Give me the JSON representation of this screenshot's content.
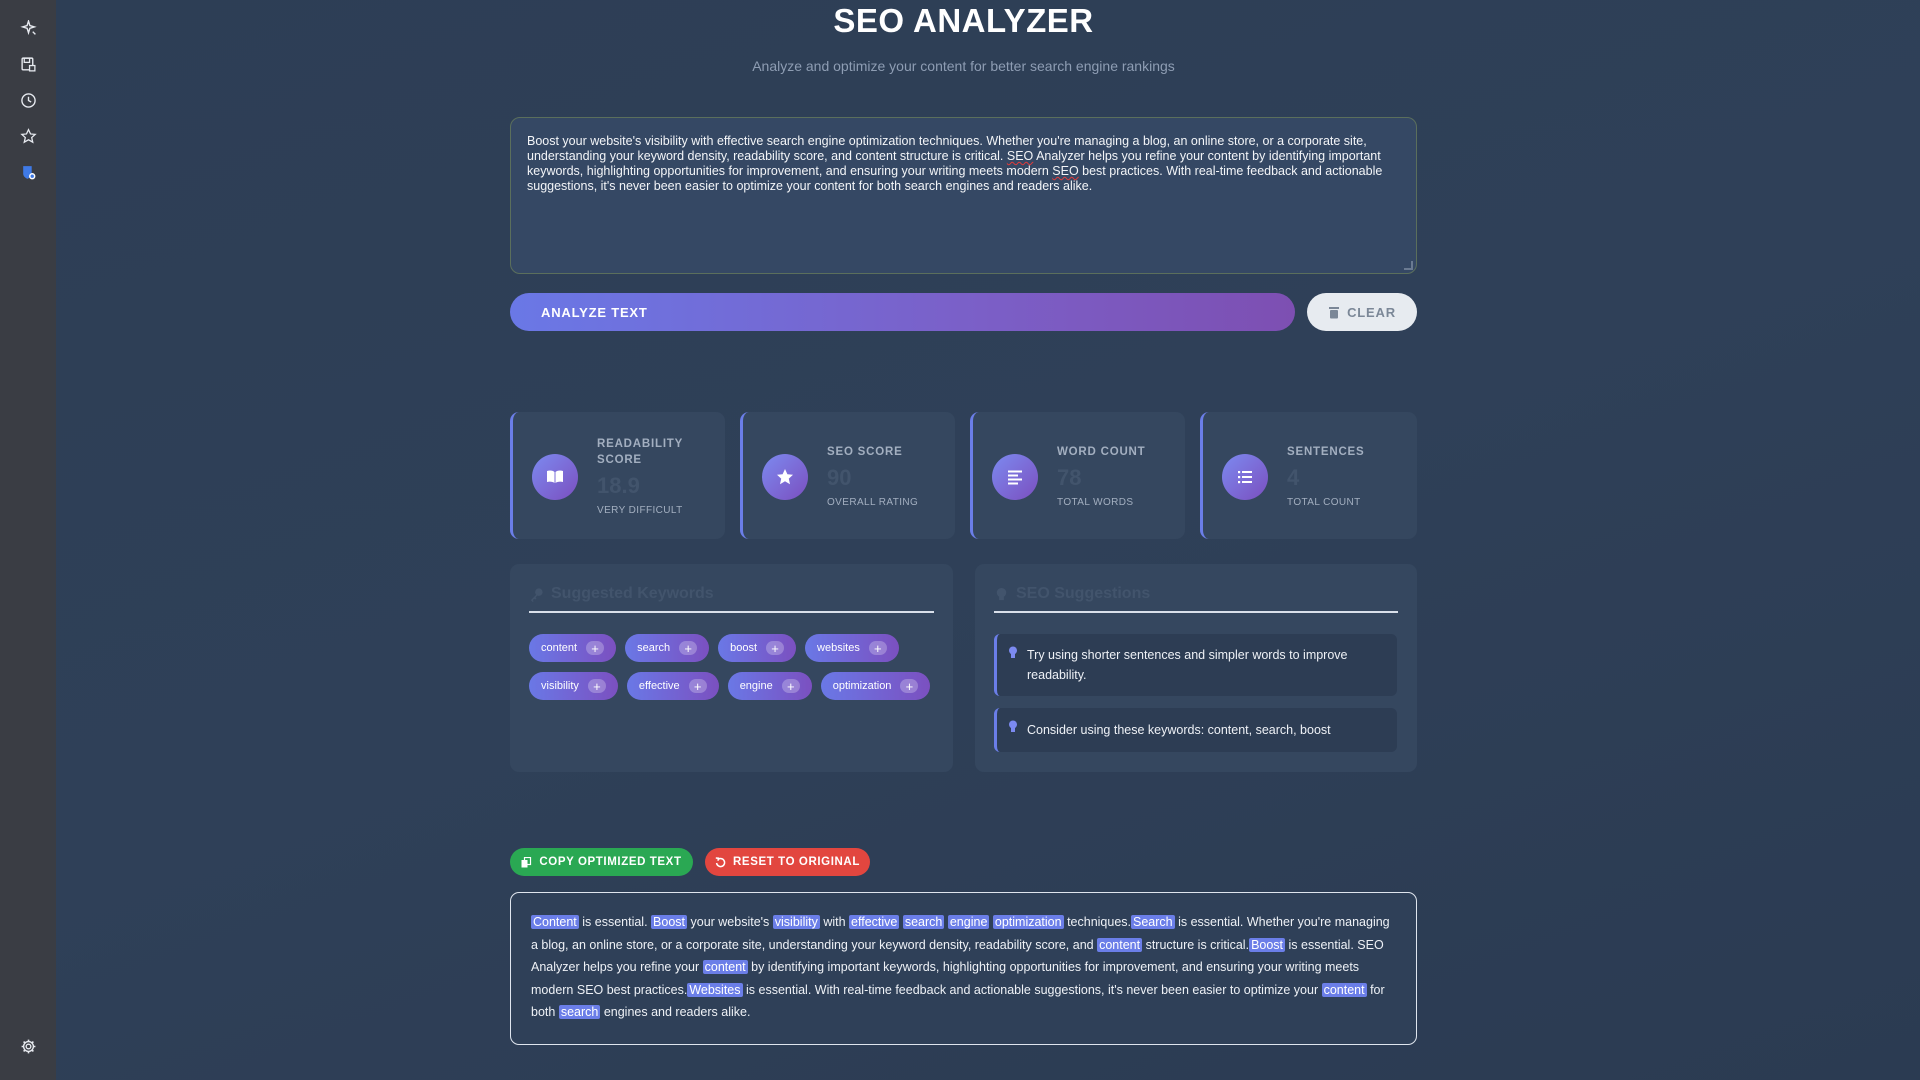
{
  "sidebar": {
    "icons": [
      "sparkle-edit-icon",
      "save-icon",
      "history-icon",
      "star-icon",
      "shield-icon"
    ],
    "bottom_icon": "settings-icon"
  },
  "header": {
    "title": "SEO ANALYZER",
    "subtitle": "Analyze and optimize your content for better search engine rankings"
  },
  "editor": {
    "segments": [
      {
        "text": "Boost your website's visibility with effective search engine optimization techniques. Whether you're managing a blog, an online store, or a corporate site, understanding your keyword density, readability score, and content structure is critical. ",
        "spell": false
      },
      {
        "text": "SEO",
        "spell": true
      },
      {
        "text": " Analyzer helps you refine your content by identifying important keywords, highlighting opportunities for improvement, and ensuring your writing meets modern ",
        "spell": false
      },
      {
        "text": "SEO",
        "spell": true
      },
      {
        "text": " best practices. With real-time feedback and actionable suggestions, it's never been easier to optimize your content for both search engines and readers alike.",
        "spell": false
      }
    ]
  },
  "actions": {
    "analyze_label": "ANALYZE TEXT",
    "clear_label": "CLEAR"
  },
  "stats": [
    {
      "label": "READABILITY SCORE",
      "value": "18.9",
      "sub": "VERY DIFFICULT",
      "icon": "book-icon"
    },
    {
      "label": "SEO SCORE",
      "value": "90",
      "sub": "OVERALL RATING",
      "icon": "star-icon"
    },
    {
      "label": "WORD COUNT",
      "value": "78",
      "sub": "TOTAL WORDS",
      "icon": "align-left-icon"
    },
    {
      "label": "SENTENCES",
      "value": "4",
      "sub": "TOTAL COUNT",
      "icon": "list-icon"
    }
  ],
  "keywords_panel": {
    "title": "Suggested Keywords",
    "keywords": [
      "content",
      "search",
      "boost",
      "websites",
      "visibility",
      "effective",
      "engine",
      "optimization"
    ]
  },
  "suggestions_panel": {
    "title": "SEO Suggestions",
    "items": [
      "Try using shorter sentences and simpler words to improve readability.",
      "Consider using these keywords: content, search, boost"
    ]
  },
  "output_actions": {
    "copy_label": "COPY OPTIMIZED TEXT",
    "reset_label": "RESET TO ORIGINAL"
  },
  "output": {
    "segments": [
      {
        "t": "Content",
        "h": true
      },
      {
        "t": " is essential. ",
        "h": false
      },
      {
        "t": "Boost",
        "h": true
      },
      {
        "t": " your website's ",
        "h": false
      },
      {
        "t": "visibility",
        "h": true
      },
      {
        "t": " with ",
        "h": false
      },
      {
        "t": "effective",
        "h": true
      },
      {
        "t": " ",
        "h": false
      },
      {
        "t": "search",
        "h": true
      },
      {
        "t": " ",
        "h": false
      },
      {
        "t": "engine",
        "h": true
      },
      {
        "t": " ",
        "h": false
      },
      {
        "t": "optimization",
        "h": true
      },
      {
        "t": " techniques.",
        "h": false
      },
      {
        "t": "Search",
        "h": true
      },
      {
        "t": " is essential. Whether you're managing a blog, an online store, or a corporate site, understanding your keyword density, readability score, and ",
        "h": false
      },
      {
        "t": "content",
        "h": true
      },
      {
        "t": " structure is critical.",
        "h": false
      },
      {
        "t": "Boost",
        "h": true
      },
      {
        "t": " is essential. SEO Analyzer helps you refine your ",
        "h": false
      },
      {
        "t": "content",
        "h": true
      },
      {
        "t": " by identifying important keywords, highlighting opportunities for improvement, and ensuring your writing meets modern SEO best practices.",
        "h": false
      },
      {
        "t": "Websites",
        "h": true
      },
      {
        "t": " is essential. With real-time feedback and actionable suggestions, it's never been easier to optimize your ",
        "h": false
      },
      {
        "t": "content",
        "h": true
      },
      {
        "t": " for both ",
        "h": false
      },
      {
        "t": "search",
        "h": true
      },
      {
        "t": " engines and readers alike.",
        "h": false
      }
    ]
  },
  "colors": {
    "accent": "#6b7ee8",
    "accent_purple": "#7b4fbf",
    "success": "#2aa853",
    "danger": "#e2463f",
    "background": "#2f4058",
    "sidebar": "#3a3d44"
  }
}
